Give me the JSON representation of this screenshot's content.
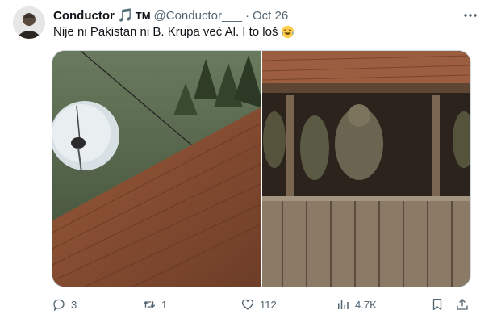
{
  "tweet": {
    "display_name": "Conductor",
    "name_emoji": "🎵",
    "name_suffix": "TM",
    "handle": "@Conductor___",
    "separator": "·",
    "date": "Oct 26",
    "text": "Nije ni Pakistan ni B. Krupa već Al. I to loš",
    "text_emoji": "laughing-tears-emoji"
  },
  "actions": {
    "reply_count": "3",
    "retweet_count": "1",
    "like_count": "112",
    "view_count": "4.7K"
  },
  "icons": {
    "avatar": "avatar",
    "more": "more-icon",
    "reply": "reply-icon",
    "retweet": "retweet-icon",
    "like": "like-icon",
    "views": "views-icon",
    "bookmark": "bookmark-icon",
    "share": "share-icon"
  },
  "colors": {
    "text": "#0f1419",
    "secondary": "#536471",
    "accent": "#1d9bf0"
  }
}
